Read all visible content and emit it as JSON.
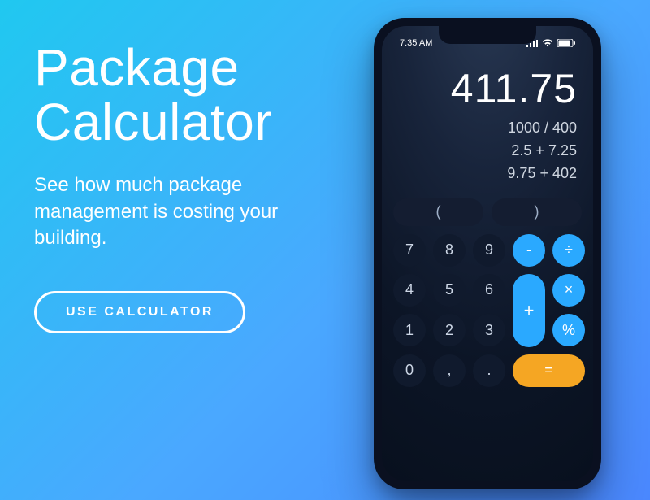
{
  "copy": {
    "headline_l1": "Package",
    "headline_l2": "Calculator",
    "subhead": "See how much package management is costing your building.",
    "cta": "USE CALCULATOR"
  },
  "phone": {
    "status": {
      "time": "7:35 AM"
    },
    "calc": {
      "result": "411.75",
      "history": [
        "1000 / 400",
        "2.5 + 7.25",
        "9.75 + 402"
      ],
      "paren_open": "(",
      "paren_close": ")",
      "k7": "7",
      "k8": "8",
      "k9": "9",
      "minus": "-",
      "divide": "÷",
      "k4": "4",
      "k5": "5",
      "k6": "6",
      "multiply": "×",
      "k1": "1",
      "k2": "2",
      "k3": "3",
      "plus": "+",
      "percent": "%",
      "k0": "0",
      "comma": ",",
      "dot": ".",
      "equals": "="
    }
  }
}
